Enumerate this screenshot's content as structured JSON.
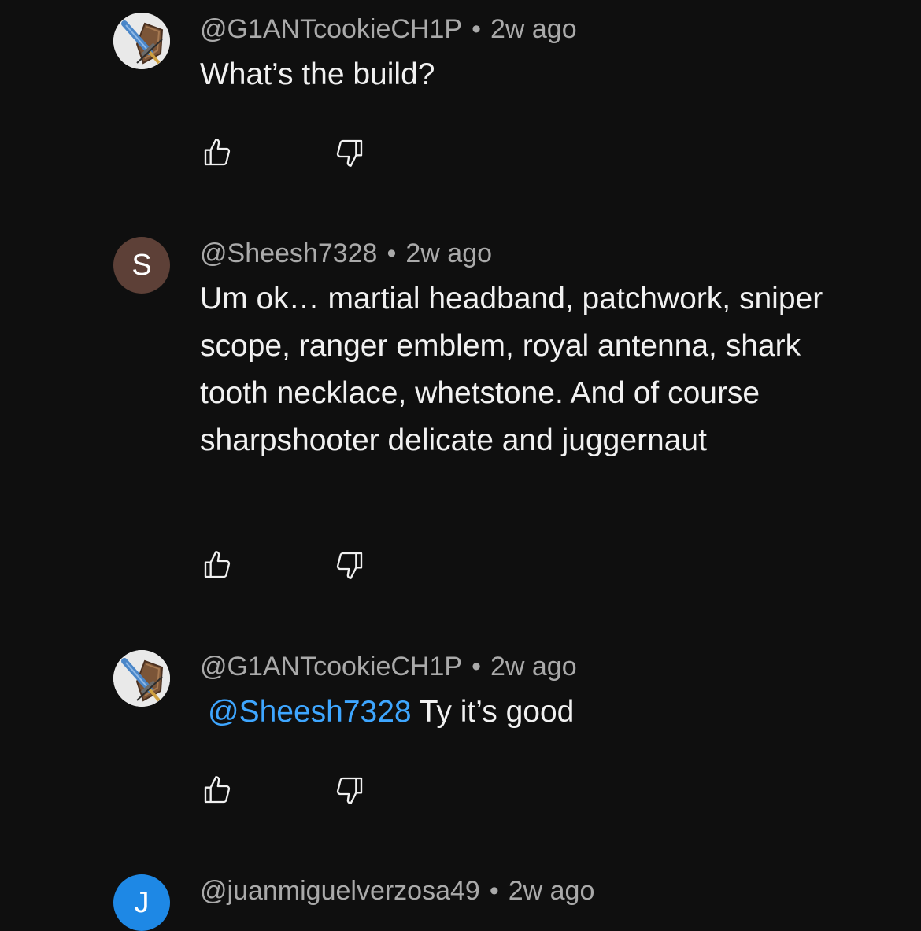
{
  "comments": [
    {
      "author": "@G1ANTcookieCH1P",
      "separator": "•",
      "time": "2w ago",
      "text": "What’s the build?",
      "avatar_icon": "sword-shield-avatar-icon"
    },
    {
      "author": "@Sheesh7328",
      "separator": "•",
      "time": "2w ago",
      "text": "Um ok… martial headband, patchwork, sniper scope, ranger emblem, royal antenna, shark tooth necklace, whetstone. And of course sharpshooter delicate and juggernaut",
      "avatar_letter": "S",
      "avatar_color": "#5d4037"
    },
    {
      "author": "@G1ANTcookieCH1P",
      "separator": "•",
      "time": "2w ago",
      "mention": "@Sheesh7328",
      "text": "Ty it’s good",
      "avatar_icon": "sword-shield-avatar-icon"
    },
    {
      "author": "@juanmiguelverzosa49",
      "separator": "•",
      "time": "2w ago",
      "avatar_letter": "J",
      "avatar_color": "#1e88e5"
    }
  ],
  "colors": {
    "background": "#0f0f0f",
    "text": "#f1f1f1",
    "meta": "#aaaaaa",
    "mention": "#3ea6ff"
  },
  "icons": {
    "like": "thumbs-up-icon",
    "dislike": "thumbs-down-icon"
  }
}
